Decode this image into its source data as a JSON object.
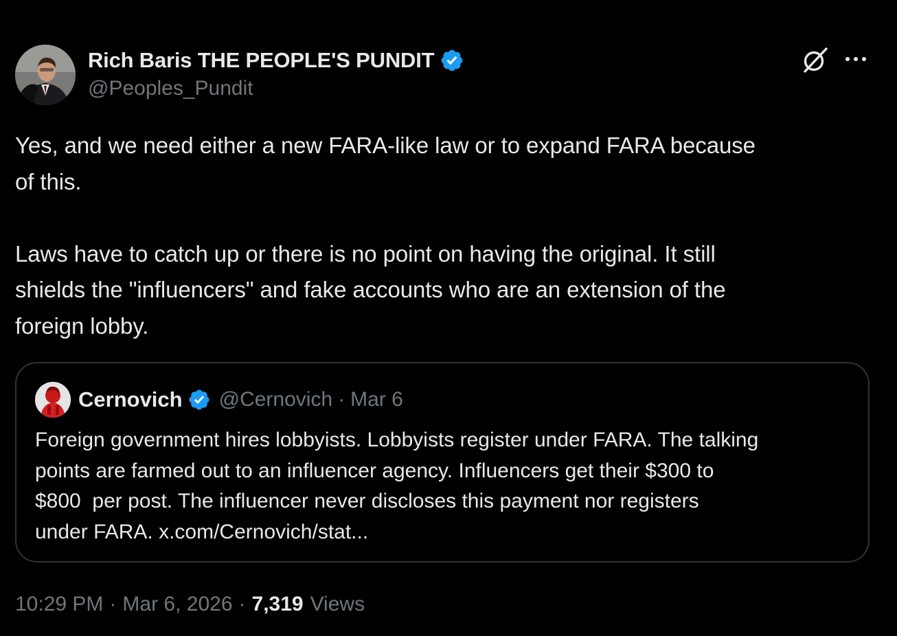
{
  "author": {
    "display_name": "Rich Baris THE PEOPLE'S PUNDIT",
    "handle": "@Peoples_Pundit",
    "verified": true
  },
  "tweet": {
    "text": "Yes, and we need either a new FARA-like law or to expand FARA because\nof this.\n\nLaws have to catch up or there is no point on having the original. It still\nshields the \"influencers\" and fake accounts who are an extension of the\nforeign lobby."
  },
  "quote": {
    "display_name": "Cernovich",
    "handle": "@Cernovich",
    "separator": "·",
    "date": "Mar 6",
    "verified": true,
    "text": "Foreign government hires lobbyists. Lobbyists register under FARA. The talking\npoints are farmed out to an influencer agency. Influencers get their $300 to\n$800  per post. The influencer never discloses this payment nor registers\nunder FARA. x.com/Cernovich/stat..."
  },
  "meta": {
    "time": "10:29 PM",
    "separator": "·",
    "date": "Mar 6, 2026",
    "views_count": "7,319",
    "views_label": "Views"
  },
  "icons": {
    "grok": "grok-icon",
    "more": "more-options-icon",
    "verified": "verified-badge-icon"
  },
  "colors": {
    "background": "#000000",
    "text": "#e7e9ea",
    "secondary_text": "#71767b",
    "verified_blue": "#1d9bf0",
    "border": "#2f3336"
  }
}
